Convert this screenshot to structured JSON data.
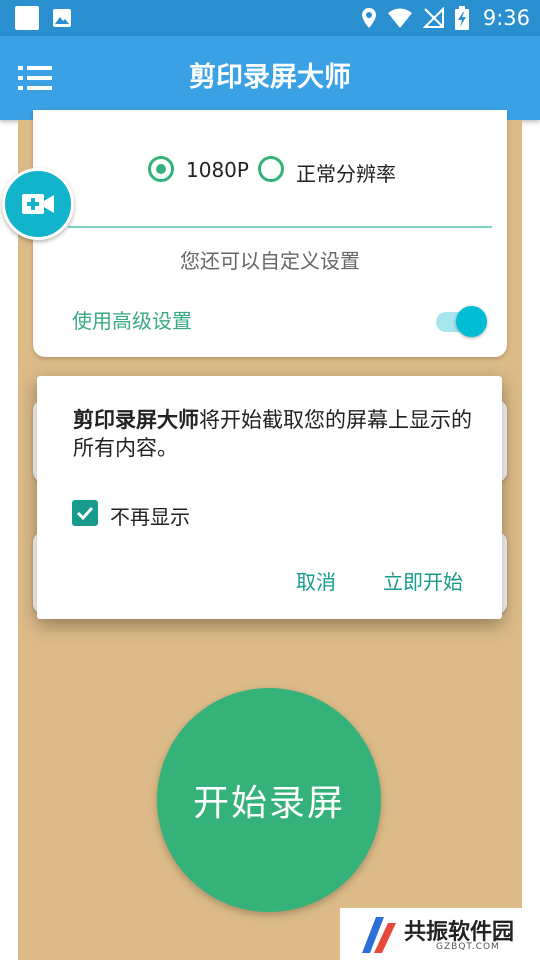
{
  "status_bar": {
    "time": "9:36"
  },
  "app_bar": {
    "title": "剪印录屏大师"
  },
  "settings_card": {
    "resolution_option_1": "1080P",
    "resolution_option_2": "正常分辨率",
    "custom_hint": "您还可以自定义设置",
    "advanced_label": "使用高级设置",
    "advanced_enabled": true
  },
  "dialog": {
    "app_name": "剪印录屏大师",
    "message_rest": "将开始截取您的屏幕上显示的所有内容。",
    "checkbox_label": "不再显示",
    "checkbox_checked": true,
    "cancel_label": "取消",
    "start_label": "立即开始"
  },
  "main": {
    "start_button_label": "开始录屏"
  },
  "watermark": {
    "text": "共振软件园",
    "subtext": "GZBQT.COM"
  },
  "colors": {
    "status_bar": "#2a8fcf",
    "app_bar": "#39a1e4",
    "panel": "#ddbb88",
    "accent_green": "#34b27a",
    "dialog_accent": "#169b8c",
    "toggle": "#00bcd4"
  }
}
